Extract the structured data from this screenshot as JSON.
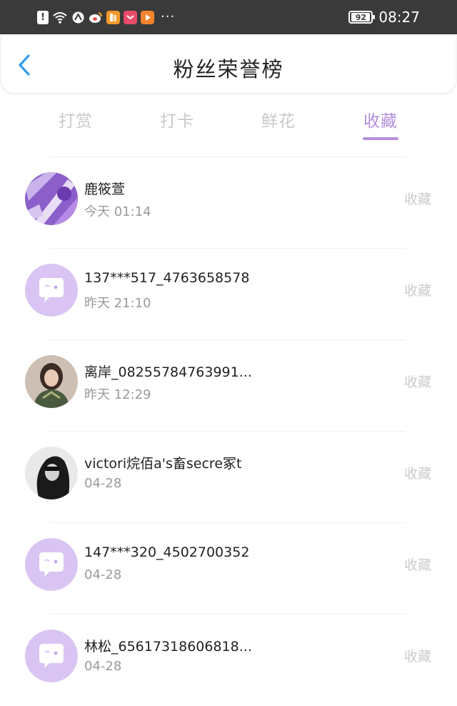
{
  "status_bar": {
    "time": "08:27",
    "battery": "92",
    "more": "···",
    "colors": {
      "background": "#3a3a3a"
    }
  },
  "header": {
    "title": "粉丝荣誉榜",
    "back_icon": "chevron-left-icon",
    "accent_color": "#2f9cf0"
  },
  "tabs": [
    {
      "label": "打赏",
      "active": false
    },
    {
      "label": "打卡",
      "active": false
    },
    {
      "label": "鲜花",
      "active": false
    },
    {
      "label": "收藏",
      "active": true
    }
  ],
  "theme": {
    "accent": "#b48fdc",
    "default_avatar_bg": "#d9c4f3"
  },
  "fans": [
    {
      "name": "鹿筱萱",
      "time": "今天 01:14",
      "action": "收藏",
      "avatar": "photo-purple"
    },
    {
      "name": "137***517_4763658578",
      "time": "昨天 21:10",
      "action": "收藏",
      "avatar": "default-chat"
    },
    {
      "name": "离岸_08255784763991...",
      "time": "昨天 12:29",
      "action": "收藏",
      "avatar": "photo-woman"
    },
    {
      "name": "victori烷佰a's畜secre冢t",
      "time": "04-28",
      "action": "收藏",
      "avatar": "photo-bw"
    },
    {
      "name": "147***320_4502700352",
      "time": "04-28",
      "action": "收藏",
      "avatar": "default-chat"
    },
    {
      "name": "林松_65617318606818...",
      "time": "04-28",
      "action": "收藏",
      "avatar": "default-chat"
    }
  ]
}
